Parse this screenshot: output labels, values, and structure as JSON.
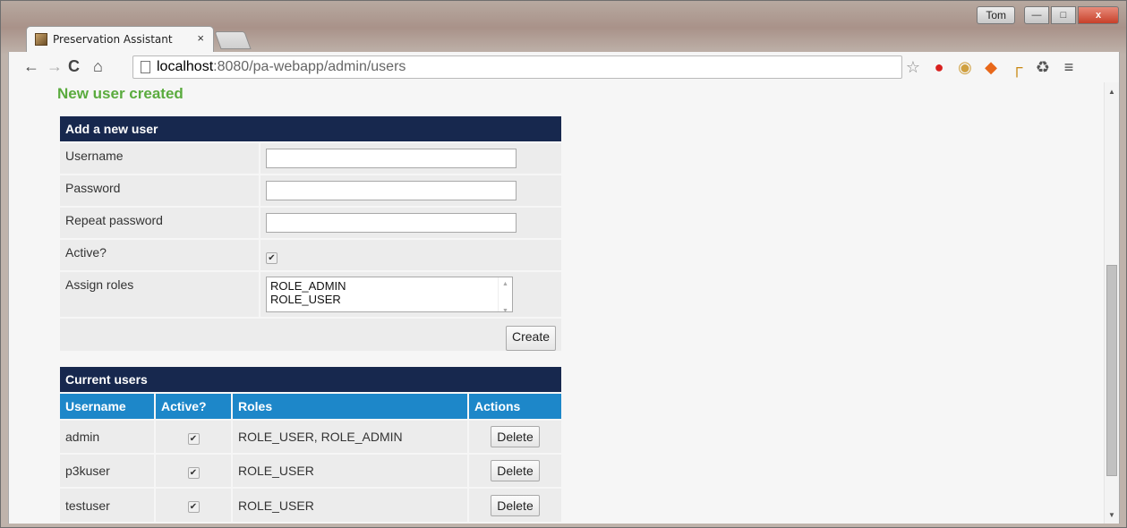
{
  "browser": {
    "tab_title": "Preservation Assistant",
    "tab_close": "×",
    "user_button": "Tom",
    "url_host": "localhost",
    "url_path": ":8080/pa-webapp/admin/users",
    "nav": {
      "back": "←",
      "forward": "→",
      "reload": "C",
      "home": "⌂"
    },
    "window_buttons": {
      "minimize": "—",
      "maximize": "□",
      "close": "x"
    },
    "toolbar_icons": [
      "bookmark-star-icon",
      "adblock-stop-icon",
      "cookie-icon",
      "color-picker-icon",
      "ruler-icon",
      "recycle-icon",
      "menu-icon"
    ]
  },
  "page": {
    "flash_message": "New user created",
    "add_user": {
      "heading": "Add a new user",
      "username_label": "Username",
      "username_value": "",
      "password_label": "Password",
      "repeat_password_label": "Repeat password",
      "active_label": "Active?",
      "active_checked": true,
      "roles_label": "Assign roles",
      "roles_options": [
        "ROLE_ADMIN",
        "ROLE_USER"
      ],
      "create_button": "Create"
    },
    "current_users": {
      "heading": "Current users",
      "columns": [
        "Username",
        "Active?",
        "Roles",
        "Actions"
      ],
      "rows": [
        {
          "username": "admin",
          "active": true,
          "roles": "ROLE_USER, ROLE_ADMIN",
          "action": "Delete"
        },
        {
          "username": "p3kuser",
          "active": true,
          "roles": "ROLE_USER",
          "action": "Delete"
        },
        {
          "username": "testuser",
          "active": true,
          "roles": "ROLE_USER",
          "action": "Delete"
        }
      ]
    }
  },
  "colors": {
    "section_header": "#17284e",
    "table_header": "#1d87c9",
    "flash": "#5aab3e"
  }
}
